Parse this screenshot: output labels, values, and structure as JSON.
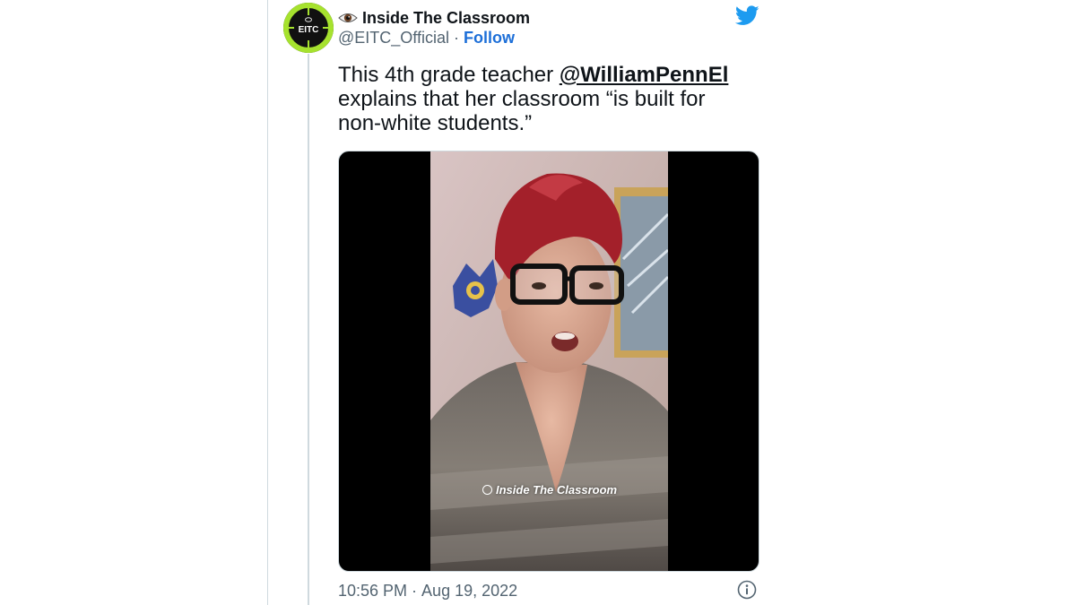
{
  "tweet": {
    "author": {
      "display_name": "Inside The Classroom",
      "handle": "@EITC_Official",
      "avatar_text": "EITC",
      "separator": "·",
      "follow_label": "Follow"
    },
    "text": {
      "before_mention": "This 4th grade teacher ",
      "mention": "@WilliamPennEl",
      "after_mention": " explains that her classroom “is built for non-white students.”"
    },
    "media": {
      "type": "video",
      "watermark": "Inside The Classroom"
    },
    "time": "10:56 PM",
    "separator": "·",
    "date": "Aug 19, 2022"
  },
  "icons": {
    "eye_emoji": "eye-icon",
    "brand": "twitter-bird-icon",
    "info": "info-icon"
  },
  "colors": {
    "follow_blue": "#1d6fd8",
    "twitter_blue": "#1d9bf0",
    "secondary_text": "#536471",
    "avatar_ring": "#a6e22e",
    "hair_red": "#a3202a"
  }
}
